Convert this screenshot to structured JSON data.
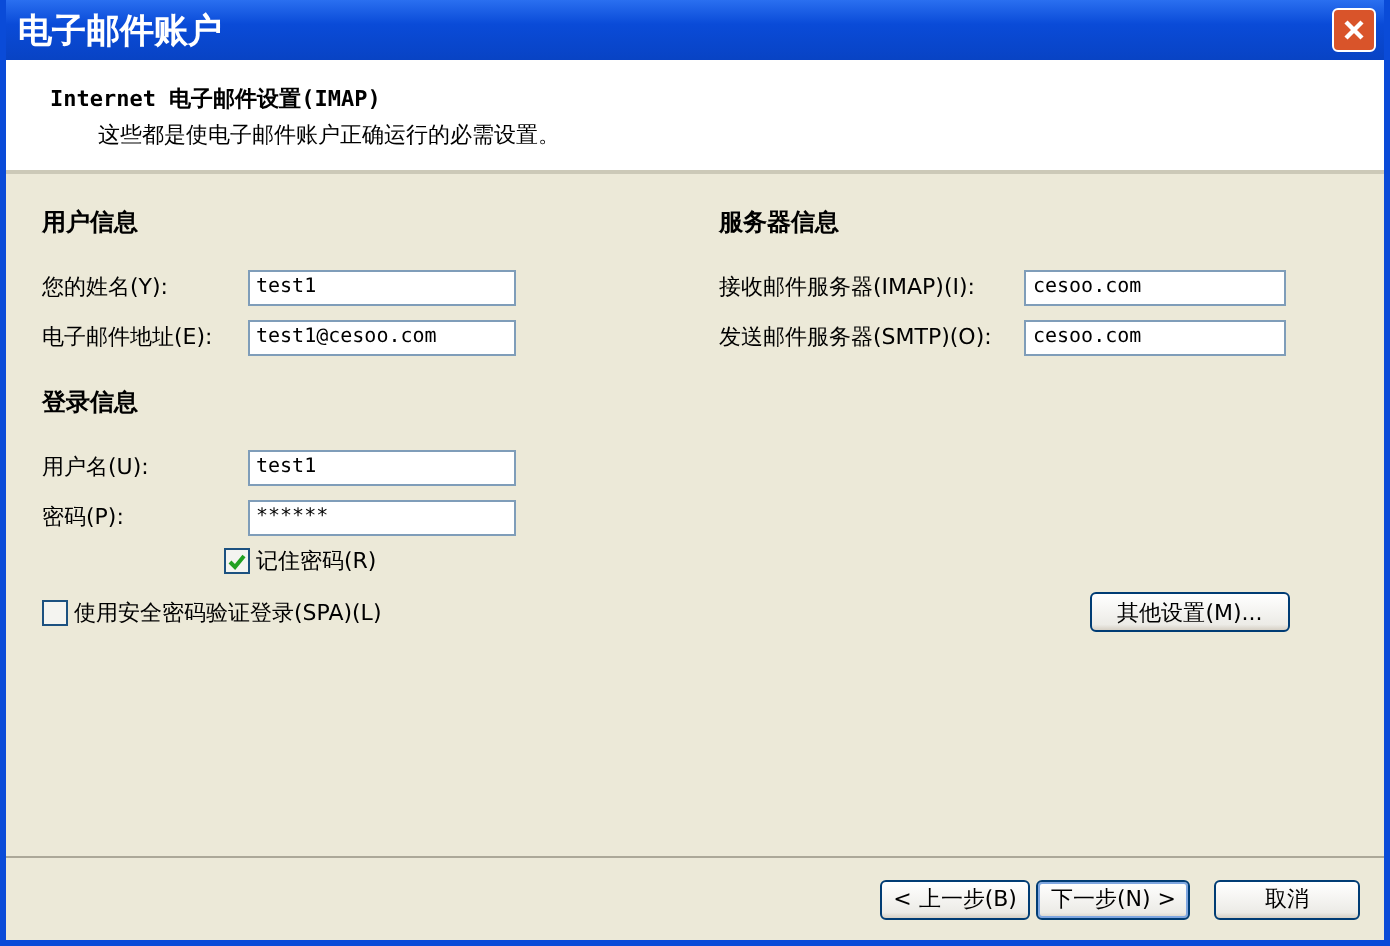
{
  "window": {
    "title": "电子邮件账户"
  },
  "header": {
    "title": "Internet 电子邮件设置(IMAP)",
    "subtitle": "这些都是使电子邮件账户正确运行的必需设置。"
  },
  "user_info": {
    "heading": "用户信息",
    "fields": [
      {
        "label": "您的姓名(Y):",
        "value": "test1"
      },
      {
        "label": "电子邮件地址(E):",
        "value": "test1@cesoo.com"
      }
    ]
  },
  "server_info": {
    "heading": "服务器信息",
    "fields": [
      {
        "label": "接收邮件服务器(IMAP)(I):",
        "value": "cesoo.com"
      },
      {
        "label": "发送邮件服务器(SMTP)(O):",
        "value": "cesoo.com"
      }
    ]
  },
  "login_info": {
    "heading": "登录信息",
    "fields": [
      {
        "label": "用户名(U):",
        "value": "test1"
      },
      {
        "label": "密码(P):",
        "value": "******"
      }
    ],
    "remember_password": {
      "label": "记住密码(R)",
      "checked": true
    }
  },
  "spa": {
    "label": "使用安全密码验证登录(SPA)(L)",
    "checked": false
  },
  "more_settings_button": "其他设置(M)...",
  "buttons": [
    {
      "label": "< 上一步(B)",
      "default": false
    },
    {
      "label": "下一步(N) >",
      "default": true
    },
    {
      "label": "取消",
      "default": false
    }
  ]
}
